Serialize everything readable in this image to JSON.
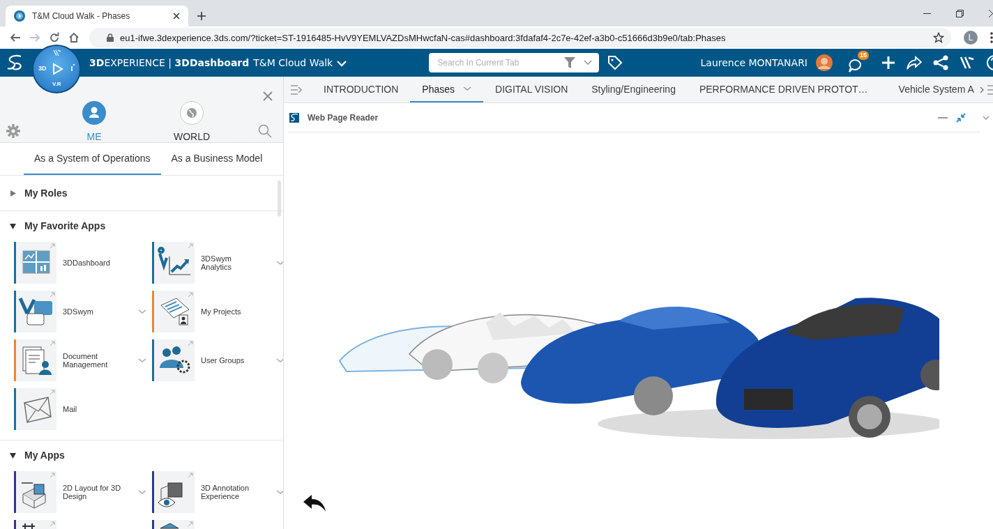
{
  "browser": {
    "tabs": [
      {
        "title": "T&M Cloud Walk - Phases",
        "selected": true
      }
    ],
    "url": "eu1-ifwe.3dexperience.3ds.com/?ticket=ST-1916485-HvV9YEMLVAZDsMHwcfaN-cas#dashboard:3fdafaf4-2c7e-42ef-a3b0-c51666d3b9e0/tab:Phases",
    "profile_initial": "L"
  },
  "app_bar": {
    "brand": "**3D**EXPERIENCE | **3DDashboard**",
    "dashboard": "T&M Cloud Walk",
    "search": {
      "placeholder": "Search In Current Tab"
    },
    "user": "Laurence MONTANARI",
    "notifications": "15"
  },
  "compass": {
    "left": "3D",
    "bottom": "V.R"
  },
  "left_panel": {
    "modes": [
      {
        "label": "ME",
        "selected": true
      },
      {
        "label": "WORLD",
        "selected": false
      }
    ],
    "views": [
      {
        "label": "As a System of Operations",
        "selected": true
      },
      {
        "label": "As a Business Model",
        "selected": false
      }
    ],
    "sections": [
      {
        "title": "My Roles",
        "expanded": false
      },
      {
        "title": "My Favorite Apps",
        "expanded": true,
        "apps": [
          {
            "name": "3DDashboard",
            "color": "#1f6e9c",
            "menu": false
          },
          {
            "name": "3DSwym Analytics",
            "color": "#1f6e9c",
            "menu": true
          },
          {
            "name": "3DSwym",
            "color": "#1f6e9c",
            "menu": true
          },
          {
            "name": "My Projects",
            "color": "#e8873a",
            "menu": false
          },
          {
            "name": "Document Management",
            "color": "#e8873a",
            "menu": true
          },
          {
            "name": "User Groups",
            "color": "#1f6e9c",
            "menu": true
          },
          {
            "name": "Mail",
            "color": "#1f6e9c",
            "menu": false
          }
        ]
      },
      {
        "title": "My Apps",
        "expanded": true,
        "apps": [
          {
            "name": "2D Layout for 3D Design",
            "color": "#2e3a87",
            "menu": true
          },
          {
            "name": "3D Annotation Experience",
            "color": "#2e3a87",
            "menu": true
          },
          {
            "color": "#2e3a87",
            "menu": false
          },
          {
            "color": "#2e3a87",
            "menu": false
          }
        ]
      }
    ]
  },
  "dashboard_tabs": [
    {
      "label": "INTRODUCTION",
      "selected": false
    },
    {
      "label": "Phases",
      "selected": true
    },
    {
      "label": "DIGITAL VISION",
      "selected": false
    },
    {
      "label": "Styling/Engineering",
      "selected": false
    },
    {
      "label": "PERFORMANCE DRIVEN PROTOT…",
      "selected": false
    },
    {
      "label": "Vehicle System A",
      "selected": false
    }
  ],
  "widget": {
    "title": "Web Page Reader"
  }
}
